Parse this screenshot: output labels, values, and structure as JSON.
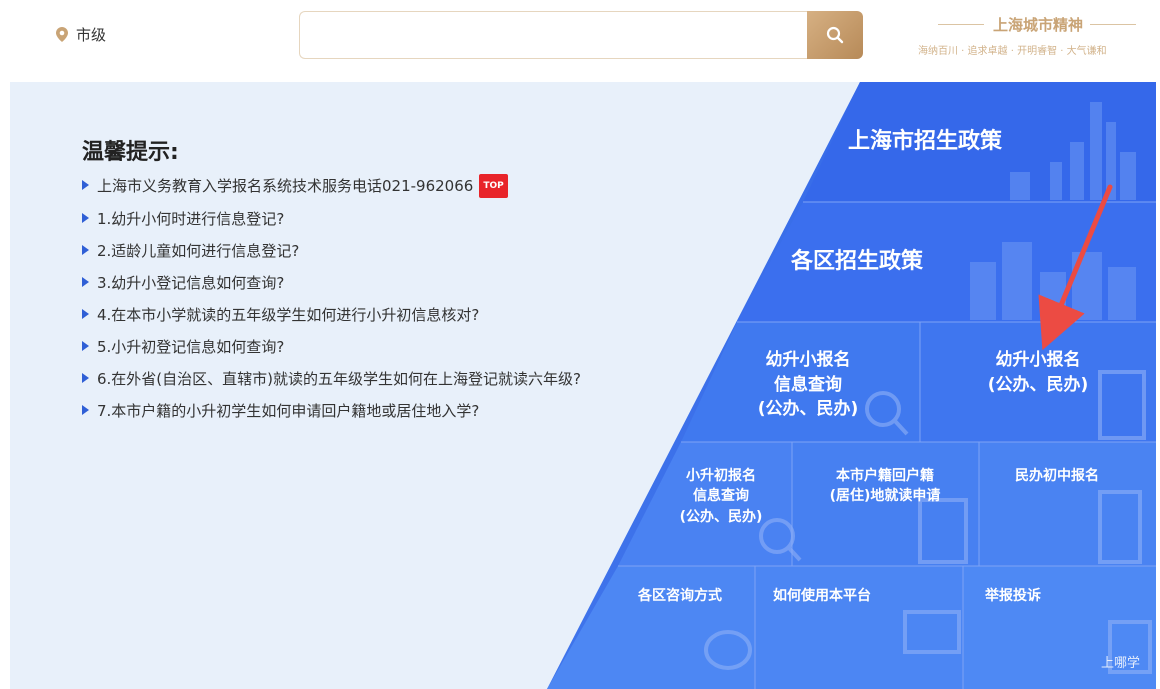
{
  "header": {
    "location": "市级",
    "search_placeholder": "",
    "spirit_title": "上海城市精神",
    "spirit_sub": "海纳百川 · 追求卓越 · 开明睿智 · 大气谦和"
  },
  "tips": {
    "title": "温馨提示:",
    "items": [
      "上海市义务教育入学报名系统技术服务电话021-962066",
      "1.幼升小何时进行信息登记?",
      "2.适龄儿童如何进行信息登记?",
      "3.幼升小登记信息如何查询?",
      "4.在本市小学就读的五年级学生如何进行小升初信息核对?",
      "5.小升初登记信息如何查询?",
      "6.在外省(自治区、直辖市)就读的五年级学生如何在上海登记就读六年级?",
      "7.本市户籍的小升初学生如何申请回户籍地或居住地入学?"
    ],
    "top_badge": "TOP"
  },
  "pyramid": {
    "shanghai_policy": "上海市招生政策",
    "district_policy": "各区招生政策",
    "k_to_p_query": [
      "幼升小报名",
      "信息查询",
      "(公办、民办)"
    ],
    "k_to_p_register": [
      "幼升小报名",
      "(公办、民办)"
    ],
    "p_to_m_query": [
      "小升初报名",
      "信息查询",
      "(公办、民办)"
    ],
    "hukou_apply": [
      "本市户籍回户籍",
      "(居住)地就读申请"
    ],
    "private_middle": "民办初中报名",
    "district_contact": "各区咨询方式",
    "how_to_use": "如何使用本平台",
    "report": "举报投诉"
  },
  "watermark": "上哪学",
  "colors": {
    "accent_gold": "#c9a476",
    "pyramid_blue": "#3d74ea",
    "arrow_red": "#ec4b43",
    "bullet_blue": "#2f5fd6",
    "top_red": "#e8242a"
  }
}
